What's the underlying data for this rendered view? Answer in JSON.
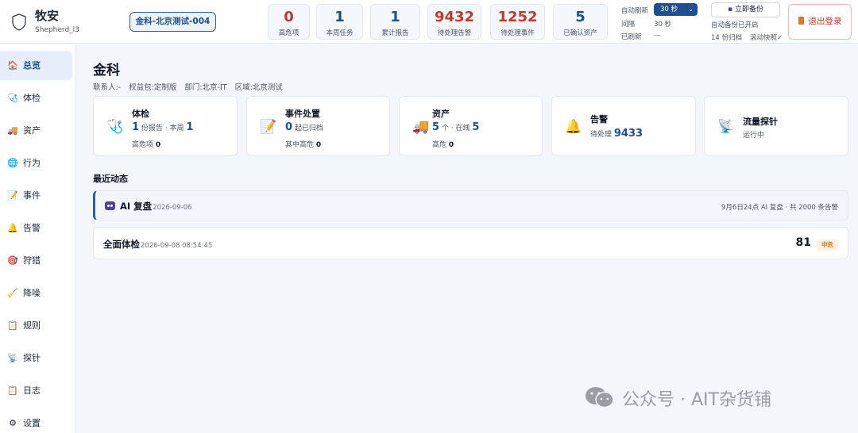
{
  "header": {
    "brand_name": "牧安",
    "user": "Shepherd_l3",
    "tenant": "金科-北京测试-004",
    "stats": [
      {
        "value": "0",
        "label": "高危项",
        "color": "red"
      },
      {
        "value": "1",
        "label": "本周任务",
        "color": "blue"
      },
      {
        "value": "1",
        "label": "累计报告",
        "color": "blue"
      },
      {
        "value": "9432",
        "label": "待处理告警",
        "color": "red"
      },
      {
        "value": "1252",
        "label": "待处理事件",
        "color": "red"
      },
      {
        "value": "5",
        "label": "已确认资产",
        "color": "blue"
      }
    ],
    "refresh": {
      "auto_label": "自动刷新",
      "selected": "30 秒",
      "interval_label": "间隔",
      "interval_value": "30 秒",
      "last_label": "已刷新",
      "last_value": "—"
    },
    "backup": {
      "button_label": "立即备份",
      "status": "自动备份已开启",
      "archived": "14 份归档",
      "snapshot": "滚动快照✓"
    },
    "logout_label": "退出登录"
  },
  "sidebar": {
    "items": [
      {
        "label": "总览",
        "icon": "home-icon",
        "glyph": "🏠"
      },
      {
        "label": "体检",
        "icon": "stethoscope-icon",
        "glyph": "🩺"
      },
      {
        "label": "资产",
        "icon": "truck-icon",
        "glyph": "🚚"
      },
      {
        "label": "行为",
        "icon": "globe-icon",
        "glyph": "🌐"
      },
      {
        "label": "事件",
        "icon": "memo-icon",
        "glyph": "📝"
      },
      {
        "label": "告警",
        "icon": "bell-icon",
        "glyph": "🔔"
      },
      {
        "label": "狩猎",
        "icon": "target-icon",
        "glyph": "🎯"
      },
      {
        "label": "降噪",
        "icon": "broom-icon",
        "glyph": "🧹"
      },
      {
        "label": "规则",
        "icon": "clipboard-icon",
        "glyph": "📋"
      },
      {
        "label": "探针",
        "icon": "satellite-icon",
        "glyph": "📡"
      },
      {
        "label": "日志",
        "icon": "log-icon",
        "glyph": "📋"
      },
      {
        "label": "设置",
        "icon": "gear-icon",
        "glyph": "⚙"
      }
    ]
  },
  "main": {
    "title": "金科",
    "meta": {
      "contact": "联系人:-",
      "package": "权益包:定制版",
      "department": "部门:北京-IT",
      "region": "区域:北京测试"
    },
    "cards": {
      "checkup": {
        "title": "体检",
        "reports": "1",
        "reports_unit": "份报告 · 本周",
        "week": "1",
        "high_label": "高危项",
        "high": "0",
        "glyph": "🩺"
      },
      "incident": {
        "title": "事件处置",
        "archived": "0",
        "archived_unit": "起已归档",
        "high_label": "其中高危",
        "high": "0",
        "glyph": "📝"
      },
      "assets": {
        "title": "资产",
        "count": "5",
        "count_unit": "个 · 在线",
        "online": "5",
        "high_label": "高危",
        "high": "0",
        "glyph": "🚚"
      },
      "alerts": {
        "title": "告警",
        "pending_label": "待处理",
        "pending": "9433",
        "glyph": "🔔"
      },
      "probe": {
        "title": "流量探针",
        "status": "运行中",
        "glyph": "📡"
      }
    },
    "recent_title": "最近动态",
    "activities": {
      "ai": {
        "title": "AI 复盘",
        "date": "2026-09-06",
        "summary": "9月6日24点 AI 复盘 · 共 2000 条告警"
      },
      "full": {
        "title": "全面体检",
        "date": "2026-09-08 08:54:45",
        "score": "81",
        "severity": "中危"
      }
    }
  },
  "watermark": {
    "text": "公众号 · AIT杂货铺"
  },
  "colors": {
    "accent": "#1e4f8f",
    "danger": "#c0392b",
    "warning": "#d97706",
    "background": "#f3f6fa"
  }
}
